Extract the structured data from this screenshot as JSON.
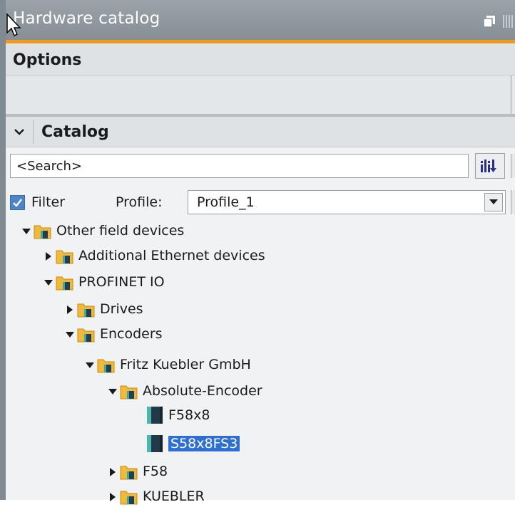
{
  "panel": {
    "title": "Hardware catalog",
    "options_label": "Options",
    "catalog_label": "Catalog"
  },
  "search": {
    "placeholder": "<Search>"
  },
  "filter": {
    "label": "Filter",
    "checked": true
  },
  "profile": {
    "label": "Profile:",
    "value": "Profile_1"
  },
  "tree": [
    {
      "label": "Other field devices",
      "level": 0,
      "expanded": true,
      "type": "folder"
    },
    {
      "label": "Additional Ethernet devices",
      "level": 1,
      "expanded": false,
      "type": "folder"
    },
    {
      "label": "PROFINET IO",
      "level": 1,
      "expanded": true,
      "type": "folder"
    },
    {
      "label": "Drives",
      "level": 2,
      "expanded": false,
      "type": "folder"
    },
    {
      "label": "Encoders",
      "level": 2,
      "expanded": true,
      "type": "folder"
    },
    {
      "label": "Fritz Kuebler GmbH",
      "level": 3,
      "expanded": true,
      "type": "folder"
    },
    {
      "label": "Absolute-Encoder",
      "level": 4,
      "expanded": true,
      "type": "folder"
    },
    {
      "label": "F58x8",
      "level": 5,
      "type": "device"
    },
    {
      "label": "S58x8FS3",
      "level": 5,
      "type": "device",
      "selected": true
    },
    {
      "label": "F58",
      "level": 4,
      "expanded": false,
      "type": "folder"
    },
    {
      "label": "KUEBLER",
      "level": 4,
      "expanded": false,
      "type": "folder"
    }
  ],
  "colors": {
    "accent": "#f29a1f",
    "selection": "#2e6fd6",
    "titlebar": "#8e979e"
  },
  "icons": {
    "collapse": "chevron-down-icon",
    "search_button": "find-icon",
    "folder": "folder-icon",
    "device": "device-module-icon"
  }
}
